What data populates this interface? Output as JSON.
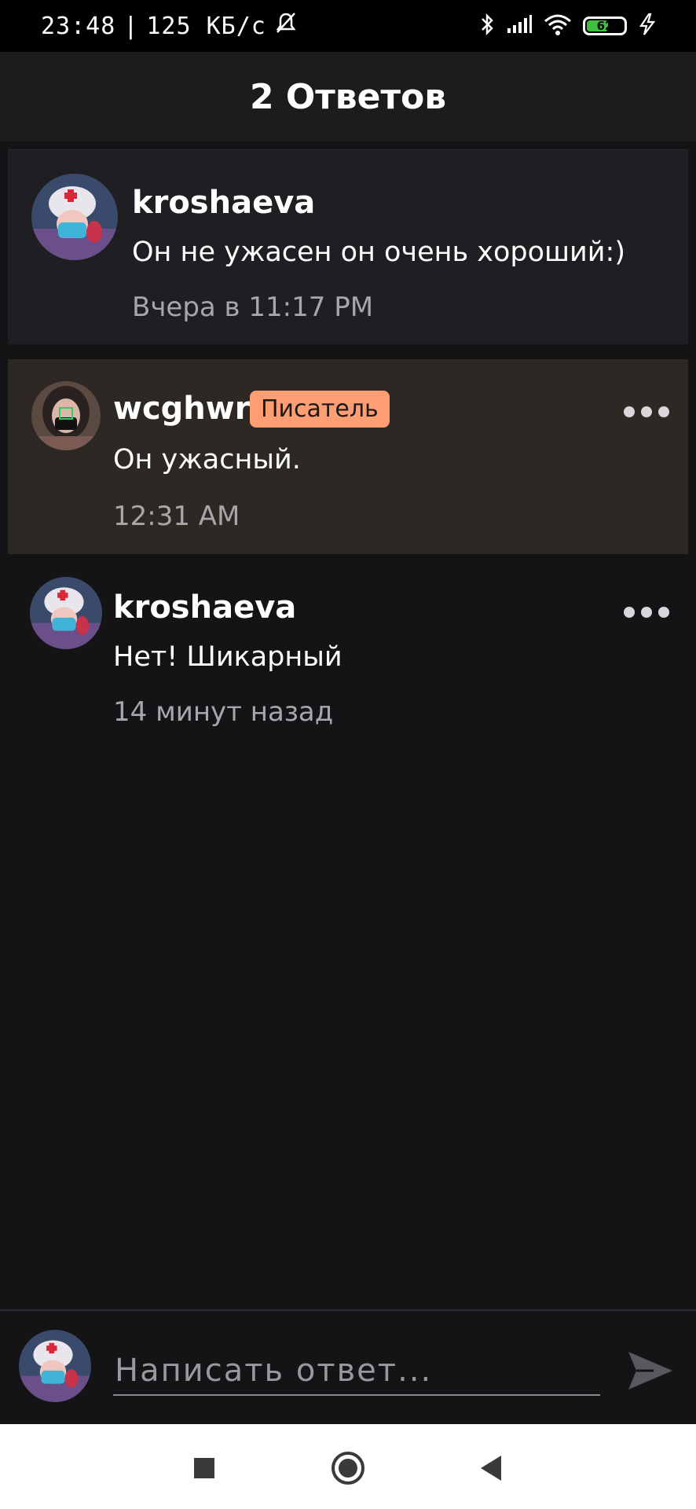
{
  "status_bar": {
    "time": "23:48",
    "separator": "|",
    "network_speed": "125 КБ/с",
    "battery_level": "62",
    "icons": [
      "mute-bell-icon",
      "bluetooth-icon",
      "signal-icon",
      "wifi-icon",
      "battery-icon",
      "charging-icon"
    ]
  },
  "header": {
    "title": "2 Ответов"
  },
  "comments": [
    {
      "username": "kroshaeva",
      "message": "Он не ужасен он очень хороший:)",
      "timestamp": "Вчера в 11:17 PM"
    },
    {
      "username": "wcghwr",
      "badge": "Писатель",
      "message": "Он ужасный.",
      "timestamp": "12:31 AM"
    },
    {
      "username": "kroshaeva",
      "message": "Нет! Шикарный",
      "timestamp": "14 минут назад"
    }
  ],
  "reply": {
    "placeholder": "Написать ответ..."
  },
  "colors": {
    "background": "#141316",
    "header": "#1c1b1e",
    "highlight_row": "#2e2825",
    "badge": "#ff9e73",
    "battery": "#3fbf3f"
  }
}
